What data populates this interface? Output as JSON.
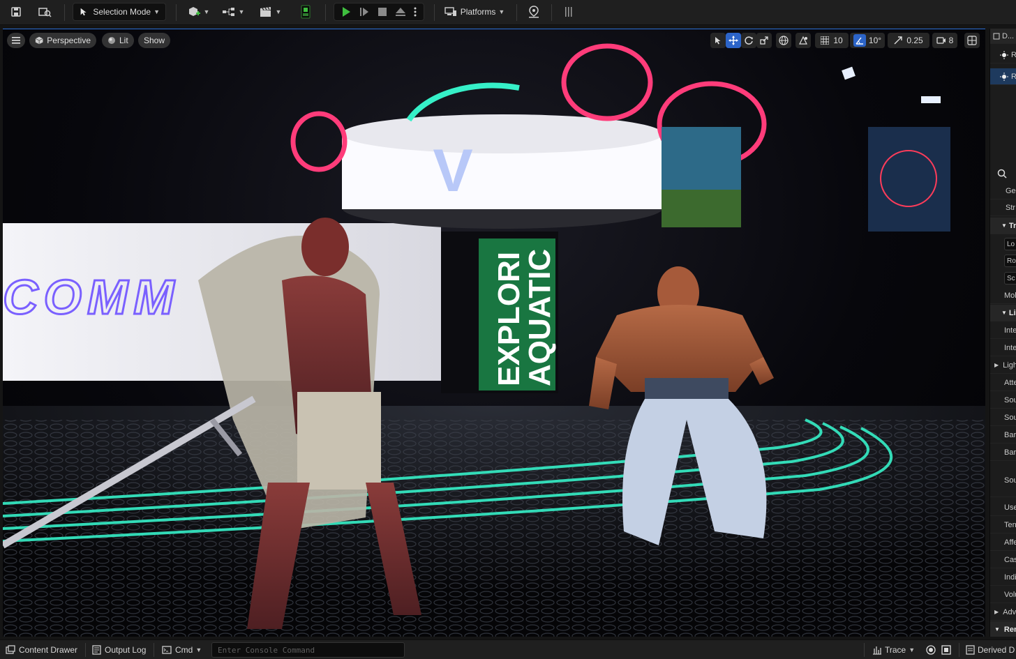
{
  "toolbar": {
    "selection_mode": "Selection Mode",
    "platforms": "Platforms"
  },
  "viewport": {
    "perspective": "Perspective",
    "lit": "Lit",
    "show": "Show",
    "grid_snap": "10",
    "rotation_snap": "10°",
    "scale_snap": "0.25",
    "camera_speed": "8",
    "scene": {
      "left_screen_text": "COMM",
      "pillar_line1": "EXPLORI",
      "pillar_line2": "AQUATIC",
      "top_sign": "V"
    }
  },
  "details": {
    "tab_title": "D...",
    "row1": "R",
    "row2": "R",
    "rows": [
      "Ger",
      "Str",
      "Tra",
      "Lo",
      "Ro",
      "Sc",
      "Mol",
      "Ligh",
      "Inte",
      "Inte",
      "Ligh",
      "Atte",
      "Sou",
      "Sou",
      "Bar",
      "Bar",
      "Sou",
      "Use",
      "Ten",
      "Affe",
      "Cas",
      "Indi",
      "Volu",
      "Adv",
      "Ren"
    ]
  },
  "statusbar": {
    "content_drawer": "Content Drawer",
    "output_log": "Output Log",
    "cmd": "Cmd",
    "console_placeholder": "Enter Console Command",
    "trace": "Trace",
    "derived_data": "Derived D"
  },
  "colors": {
    "accent": "#2c64c8",
    "play_green": "#3fbf3f",
    "neon_pink": "#ff3c7a",
    "neon_teal": "#36f0c8"
  }
}
